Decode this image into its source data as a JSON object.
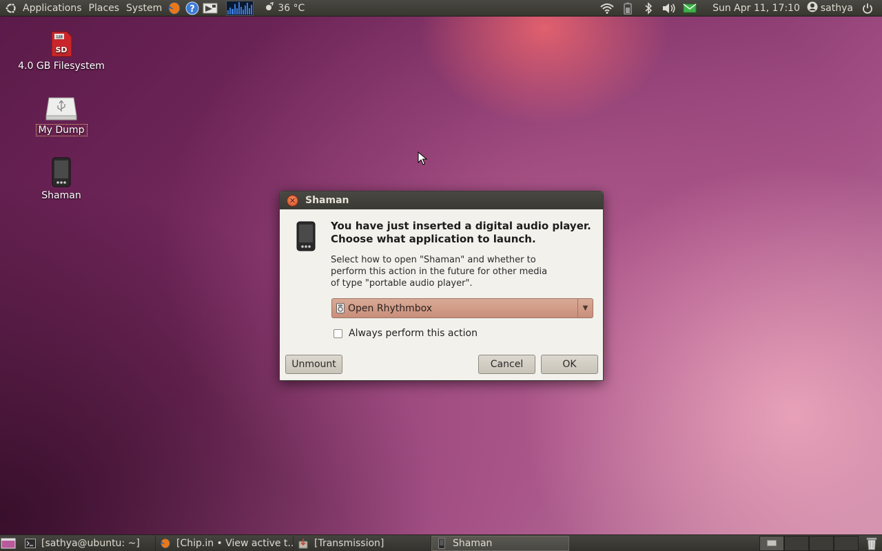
{
  "top_panel": {
    "menus": [
      "Applications",
      "Places",
      "System"
    ],
    "weather": "36 °C",
    "clock": "Sun Apr 11, 17:10",
    "user": "sathya",
    "icons": [
      "ubuntu-logo-icon",
      "firefox-icon",
      "help-icon",
      "screenshot-icon",
      "system-monitor-icon",
      "weather-icon",
      "wifi-icon",
      "battery-icon",
      "bluetooth-icon",
      "volume-icon",
      "mail-icon",
      "user-icon",
      "power-icon"
    ]
  },
  "desktop": {
    "icons": [
      {
        "label": "4.0 GB Filesystem",
        "icon": "sd-card-icon"
      },
      {
        "label": "My Dump",
        "icon": "usb-drive-icon",
        "selected": true
      },
      {
        "label": "Shaman",
        "icon": "phone-icon"
      }
    ]
  },
  "dialog": {
    "title": "Shaman",
    "headline": "You have just inserted a digital audio player. Choose what application to launch.",
    "description": "Select how to open \"Shaman\" and whether to perform this action in the future for other media of type \"portable audio player\".",
    "combo_value": "Open Rhythmbox",
    "checkbox_label": "Always perform this action",
    "checkbox_checked": false,
    "buttons": {
      "unmount": "Unmount",
      "cancel": "Cancel",
      "ok": "OK"
    }
  },
  "bottom_panel": {
    "tasks": [
      {
        "label": "[sathya@ubuntu: ~]",
        "icon": "terminal-icon"
      },
      {
        "label": "[Chip.in • View active t...",
        "icon": "firefox-icon"
      },
      {
        "label": "[Transmission]",
        "icon": "transmission-icon"
      },
      {
        "label": "Shaman",
        "icon": "phone-icon",
        "active": true
      }
    ],
    "workspace_count": 4
  },
  "colors": {
    "panel": "#3c3b37",
    "dialog_bg": "#f2f1ec",
    "combo": "#d4a08b",
    "close_button": "#e0602f"
  }
}
